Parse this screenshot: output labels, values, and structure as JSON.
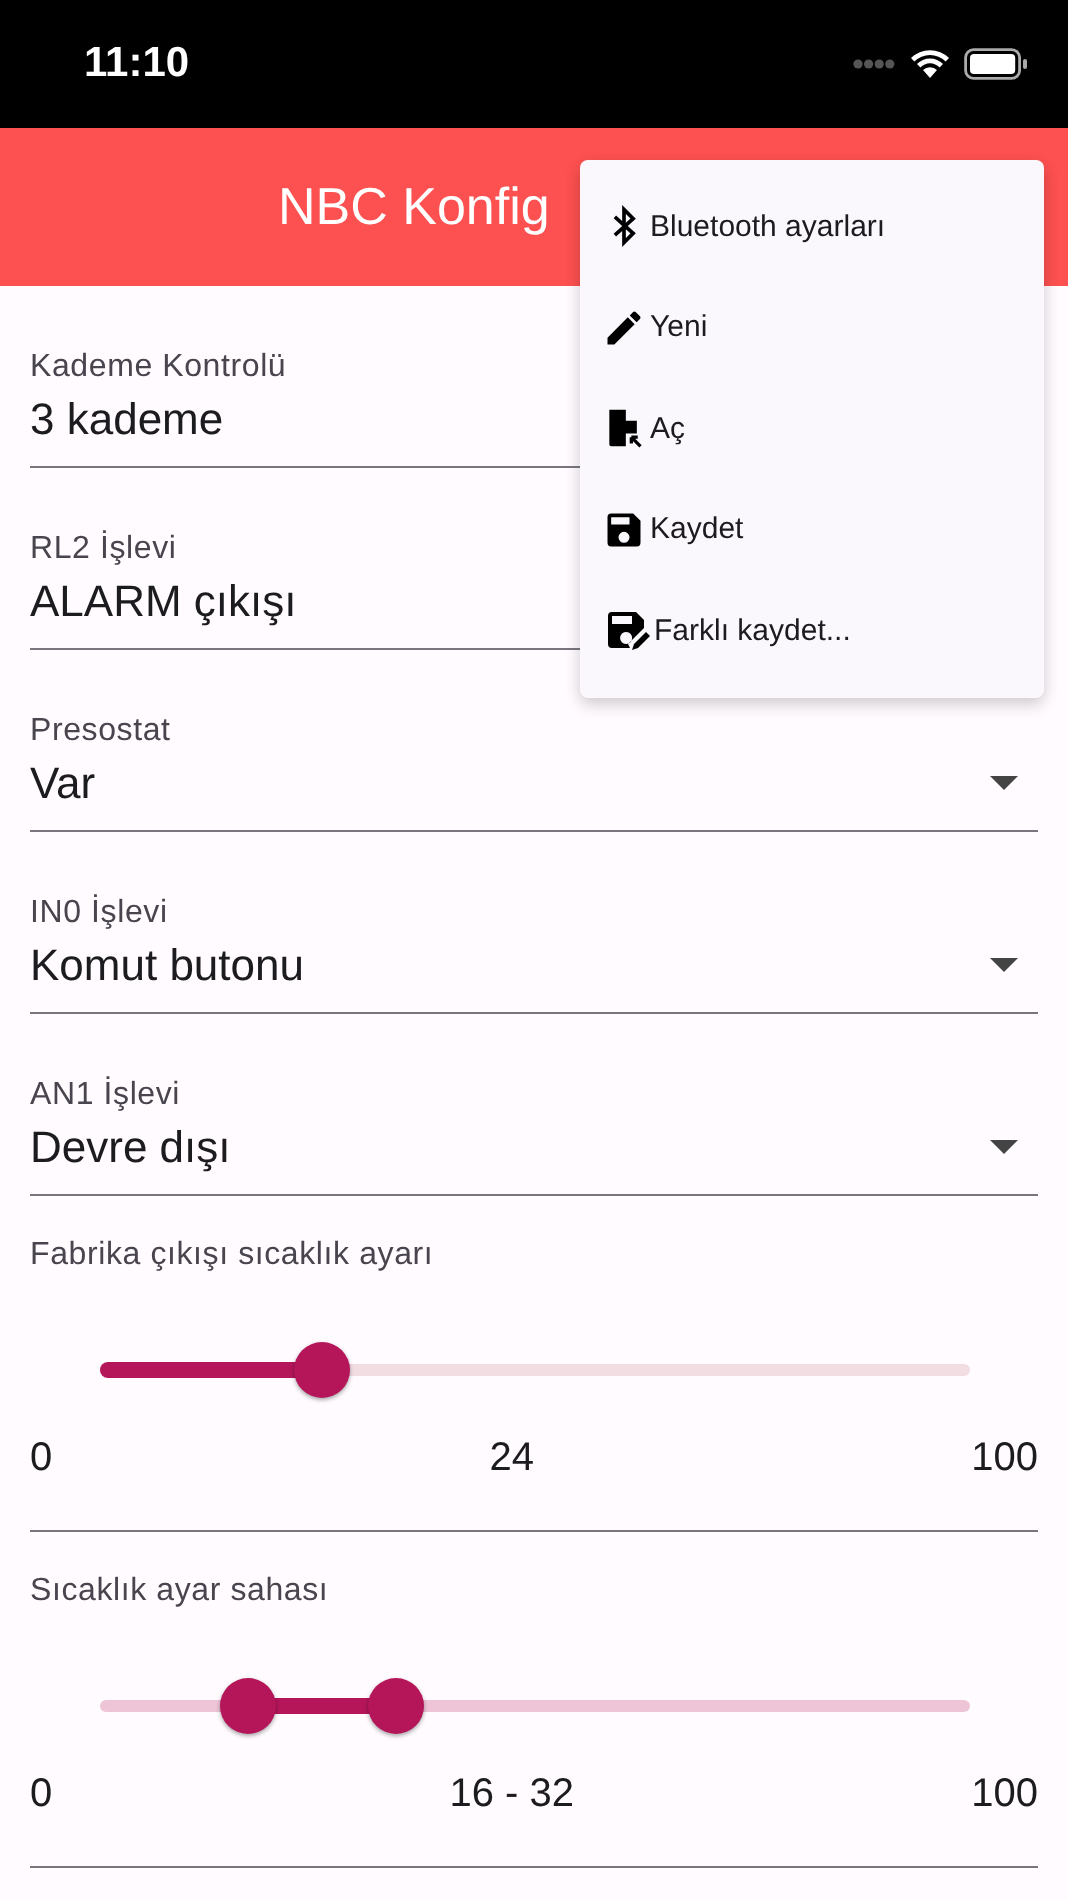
{
  "status_bar": {
    "time": "11:10"
  },
  "app_bar": {
    "title": "NBC Konfig"
  },
  "fields": [
    {
      "label": "Kademe Kontrolü",
      "value": "3 kademe"
    },
    {
      "label": "RL2 İşlevi",
      "value": "ALARM çıkışı"
    },
    {
      "label": "Presostat",
      "value": "Var"
    },
    {
      "label": "IN0 İşlevi",
      "value": "Komut butonu"
    },
    {
      "label": "AN1 İşlevi",
      "value": "Devre dışı"
    }
  ],
  "sliders": [
    {
      "kind": "single",
      "label": "Fabrika çıkışı sıcaklık ayarı",
      "min": "0",
      "reading": "24",
      "max": "100",
      "thumbs": [
        {
          "level": 0.24
        }
      ]
    },
    {
      "kind": "range",
      "label": "Sıcaklık ayar sahası",
      "min": "0",
      "reading": "16 - 32",
      "max": "100",
      "thumbs": [
        {
          "level": 0.16
        },
        {
          "level": 0.32
        }
      ]
    }
  ],
  "menu": [
    {
      "kind": "bluetooth",
      "label": "Bluetooth ayarları"
    },
    {
      "kind": "pencil",
      "label": "Yeni"
    },
    {
      "kind": "open",
      "label": "Aç"
    },
    {
      "kind": "save",
      "label": "Kaydet"
    },
    {
      "kind": "saveas",
      "label": "Farklı kaydet..."
    }
  ]
}
